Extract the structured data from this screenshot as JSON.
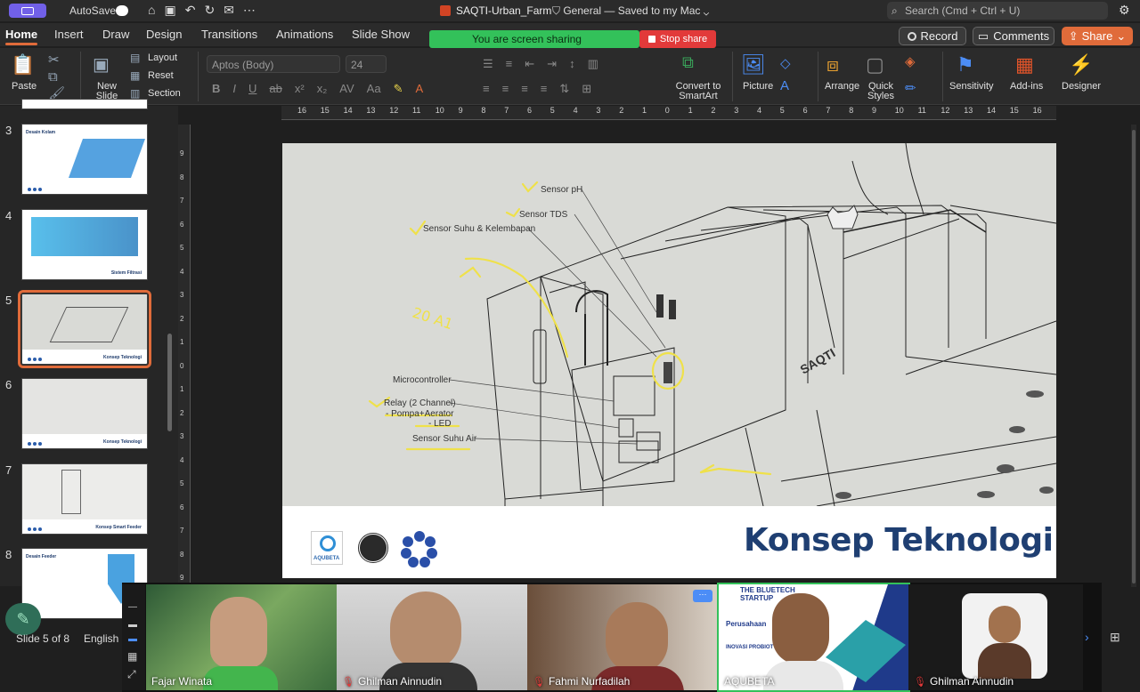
{
  "titlebar": {
    "autosave_label": "AutoSave",
    "doc_name": "SAQTI-Urban_Farm",
    "doc_status": "General — Saved to my Mac",
    "search_placeholder": "Search (Cmd + Ctrl + U)"
  },
  "tabs": [
    "Home",
    "Insert",
    "Draw",
    "Design",
    "Transitions",
    "Animations",
    "Slide Show"
  ],
  "screen_share": {
    "banner_text": "You are screen sharing",
    "stop_label": "Stop share"
  },
  "top_actions": {
    "record_label": "Record",
    "comments_label": "Comments",
    "share_label": "Share"
  },
  "ribbon": {
    "paste_label": "Paste",
    "new_slide_label": "New Slide",
    "layout_label": "Layout",
    "reset_label": "Reset",
    "section_label": "Section",
    "font_name": "Aptos (Body)",
    "font_size": "24",
    "convert_smartart_label": "Convert to SmartArt",
    "picture_label": "Picture",
    "arrange_label": "Arrange",
    "quick_styles_label": "Quick Styles",
    "sensitivity_label": "Sensitivity",
    "addins_label": "Add-ins",
    "designer_label": "Designer"
  },
  "ruler": {
    "h_ticks": [
      "16",
      "15",
      "14",
      "13",
      "12",
      "11",
      "10",
      "9",
      "8",
      "7",
      "6",
      "5",
      "4",
      "3",
      "2",
      "1",
      "0",
      "1",
      "2",
      "3",
      "4",
      "5",
      "6",
      "7",
      "8",
      "9",
      "10",
      "11",
      "12",
      "13",
      "14",
      "15",
      "16"
    ],
    "v_ticks": [
      "9",
      "8",
      "7",
      "6",
      "5",
      "4",
      "3",
      "2",
      "1",
      "0",
      "1",
      "2",
      "3",
      "4",
      "5",
      "6",
      "7",
      "8",
      "9"
    ]
  },
  "slides": [
    {
      "number": "3",
      "title": "Desain Kolam",
      "caption": ""
    },
    {
      "number": "4",
      "title": "",
      "caption": "Sistem Filtrasi"
    },
    {
      "number": "5",
      "title": "",
      "caption": "Konsep Teknologi"
    },
    {
      "number": "6",
      "title": "",
      "caption": "Konsep Teknologi"
    },
    {
      "number": "7",
      "title": "",
      "caption": "Konsep Smart Feeder"
    },
    {
      "number": "8",
      "title": "Desain Feeder",
      "caption": ""
    }
  ],
  "status": {
    "slide_position": "Slide 5 of 8",
    "language": "English"
  },
  "slide_content": {
    "heading": "Konsep Teknologi",
    "brand_text": "SAQTI",
    "logo_text": "AQUBETA",
    "callouts": {
      "sensor_ph": "Sensor pH",
      "sensor_tds": "Sensor TDS",
      "sensor_suhu_kelembapan": "Sensor Suhu & Kelembapan",
      "microcontroller": "Microcontroller",
      "relay": "Relay (2 Channel)",
      "pompa": "- Pompa+Aerator",
      "led": "- LED",
      "sensor_suhu_air": "Sensor Suhu Air"
    },
    "handwriting": "20 A1"
  },
  "participants": [
    {
      "name": "Fajar Winata",
      "muted": false
    },
    {
      "name": "Ghilman Ainnudin",
      "muted": true
    },
    {
      "name": "Fahmi Nurfadilah",
      "muted": true
    },
    {
      "name": "AQUBETA",
      "muted": false,
      "banner_line1": "THE BLUETECH",
      "banner_line2": "STARTUP",
      "banner_line3": "Perusahaan",
      "banner_line4": "INOVASI PROBIOT"
    },
    {
      "name": "Ghilman Ainnudin",
      "muted": true
    }
  ],
  "colors": {
    "accent": "#e06b3a",
    "share_green": "#33c15a",
    "stop_red": "#e23a3a",
    "heading_blue": "#1f3f72"
  }
}
